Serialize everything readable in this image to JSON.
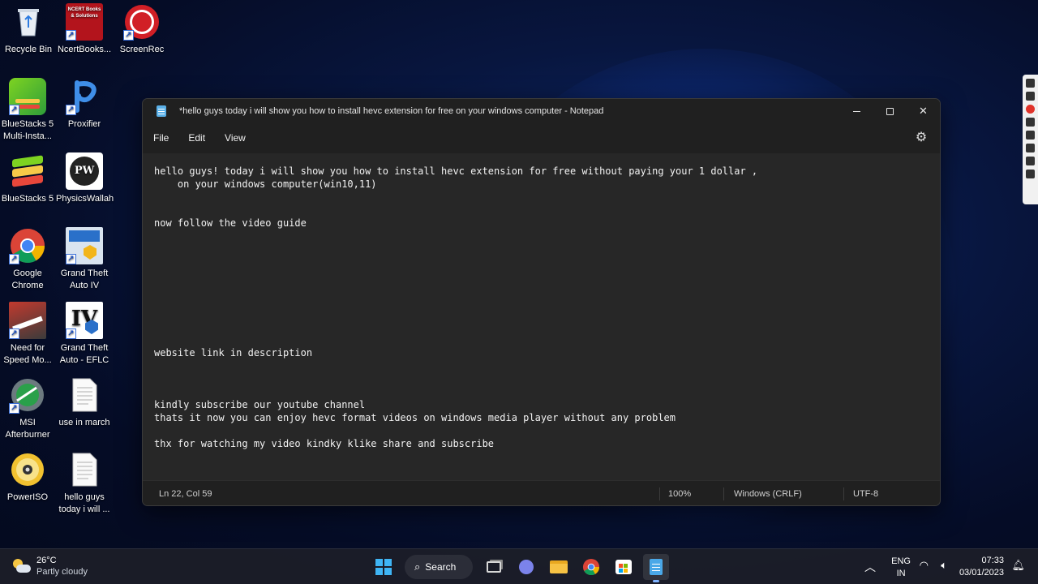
{
  "desktop": {
    "icons": [
      {
        "label": "Recycle Bin",
        "icon": "recycle-bin-icon"
      },
      {
        "label": "NcertBooks...",
        "icon": "ncert-books-icon",
        "badge_text": "NCERT Books & Solutions"
      },
      {
        "label": "ScreenRec",
        "icon": "screenrec-icon"
      },
      {
        "label": "BlueStacks 5 Multi-Insta...",
        "icon": "bluestacks-multi-instance-icon"
      },
      {
        "label": "Proxifier",
        "icon": "proxifier-icon"
      },
      {
        "label": "BlueStacks 5",
        "icon": "bluestacks-icon"
      },
      {
        "label": "PhysicsWallah",
        "icon": "physicswallah-icon",
        "badge_text": "PW"
      },
      {
        "label": "Google Chrome",
        "icon": "chrome-icon"
      },
      {
        "label": "Grand Theft Auto IV",
        "icon": "gta-iv-icon"
      },
      {
        "label": "Need for Speed Mo...",
        "icon": "need-for-speed-icon"
      },
      {
        "label": "Grand Theft Auto - EFLC",
        "icon": "gta-eflc-icon",
        "badge_text": "IV"
      },
      {
        "label": "MSI Afterburner",
        "icon": "msi-afterburner-icon"
      },
      {
        "label": "use in march",
        "icon": "text-file-icon"
      },
      {
        "label": "PowerISO",
        "icon": "poweriso-icon"
      },
      {
        "label": "hello guys today i will ...",
        "icon": "text-file-icon"
      }
    ]
  },
  "notepad": {
    "title": "*hello guys today i will show you how to install hevc extension for free on your windows computer - Notepad",
    "menu": [
      "File",
      "Edit",
      "View"
    ],
    "content": "hello guys! today i will show you how to install hevc extension for free without paying your 1 dollar ,\n    on your windows computer(win10,11)\n\n\nnow follow the video guide\n\n\n\n\n\n\n\n\n\nwebsite link in description\n\n\n\nkindly subscribe our youtube channel\nthats it now you can enjoy hevc format videos on windows media player without any problem\n\nthx for watching my video kindky klike share and subscribe",
    "status": {
      "position": "Ln 22, Col 59",
      "zoom": "100%",
      "line_ending": "Windows (CRLF)",
      "encoding": "UTF-8"
    }
  },
  "taskbar": {
    "weather": {
      "temp": "26°C",
      "condition": "Partly cloudy"
    },
    "search_label": "Search",
    "apps": [
      "start-icon",
      "task-view-icon",
      "teams-chat-icon",
      "file-explorer-icon",
      "chrome-icon",
      "microsoft-store-icon",
      "notepad-icon"
    ],
    "language": {
      "line1": "ENG",
      "line2": "IN"
    },
    "time": "07:33",
    "date": "03/01/2023"
  },
  "colors": {
    "accent": "#3fb5f5",
    "window_bg": "#202020",
    "editor_bg": "#272727"
  }
}
